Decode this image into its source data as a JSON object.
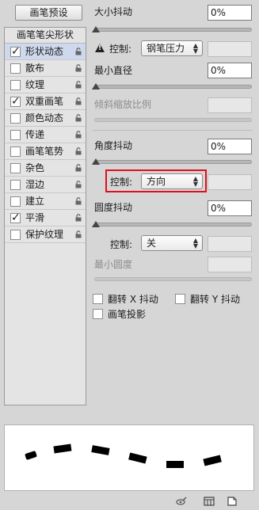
{
  "brush_presets_label": "画笔预设",
  "left_panel": {
    "header": "画笔笔尖形状",
    "items": [
      {
        "label": "形状动态",
        "checked": true,
        "selected": true,
        "locked": true
      },
      {
        "label": "散布",
        "checked": false,
        "selected": false,
        "locked": true
      },
      {
        "label": "纹理",
        "checked": false,
        "selected": false,
        "locked": true
      },
      {
        "label": "双重画笔",
        "checked": true,
        "selected": false,
        "locked": true
      },
      {
        "label": "颜色动态",
        "checked": false,
        "selected": false,
        "locked": true
      },
      {
        "label": "传递",
        "checked": false,
        "selected": false,
        "locked": true
      },
      {
        "label": "画笔笔势",
        "checked": false,
        "selected": false,
        "locked": true
      },
      {
        "label": "杂色",
        "checked": false,
        "selected": false,
        "locked": true
      },
      {
        "label": "湿边",
        "checked": false,
        "selected": false,
        "locked": true
      },
      {
        "label": "建立",
        "checked": false,
        "selected": false,
        "locked": true
      },
      {
        "label": "平滑",
        "checked": true,
        "selected": false,
        "locked": true
      },
      {
        "label": "保护纹理",
        "checked": false,
        "selected": false,
        "locked": true
      }
    ]
  },
  "size_jitter": {
    "label": "大小抖动",
    "value": "0%"
  },
  "size_control": {
    "label": "控制:",
    "value": "钢笔压力"
  },
  "min_diameter": {
    "label": "最小直径",
    "value": "0%"
  },
  "tilt_scale": {
    "label": "倾斜缩放比例",
    "value": ""
  },
  "angle_jitter": {
    "label": "角度抖动",
    "value": "0%"
  },
  "angle_control": {
    "label": "控制:",
    "value": "方向"
  },
  "roundness_jitter": {
    "label": "圆度抖动",
    "value": "0%"
  },
  "roundness_control": {
    "label": "控制:",
    "value": "关"
  },
  "min_roundness": {
    "label": "最小圆度",
    "value": ""
  },
  "flip_x": {
    "label": "翻转 X 抖动",
    "checked": false
  },
  "flip_y": {
    "label": "翻转 Y 抖动",
    "checked": false
  },
  "brush_projection": {
    "label": "画笔投影",
    "checked": false
  },
  "icons": {
    "warning": "warning-icon",
    "lock": "lock-icon",
    "footer": [
      "eye-brush-icon",
      "grid-panel-icon",
      "new-page-icon"
    ]
  },
  "colors": {
    "highlight": "#e0101a",
    "selected_row": "#cfd9ee"
  }
}
